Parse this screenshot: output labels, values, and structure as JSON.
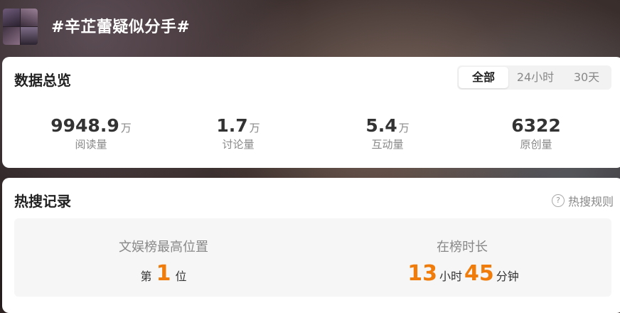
{
  "header": {
    "title": "#辛芷蕾疑似分手#"
  },
  "overview": {
    "title": "数据总览",
    "tabs": [
      "全部",
      "24小时",
      "30天"
    ],
    "active_tab": "全部",
    "stats": [
      {
        "value": "9948.9",
        "unit": "万",
        "label": "阅读量"
      },
      {
        "value": "1.7",
        "unit": "万",
        "label": "讨论量"
      },
      {
        "value": "5.4",
        "unit": "万",
        "label": "互动量"
      },
      {
        "value": "6322",
        "unit": "",
        "label": "原创量"
      }
    ]
  },
  "hot_search": {
    "title": "热搜记录",
    "rules_label": "热搜规则",
    "rules_icon": "question-circle-icon",
    "highest_position": {
      "label": "文娱榜最高位置",
      "prefix": "第",
      "value": "1",
      "suffix": "位"
    },
    "duration": {
      "label": "在榜时长",
      "hours": "13",
      "hours_unit": "小时",
      "minutes": "45",
      "minutes_unit": "分钟"
    }
  },
  "colors": {
    "accent": "#f07d0b",
    "card": "#ffffff",
    "muted_text": "#888888"
  }
}
